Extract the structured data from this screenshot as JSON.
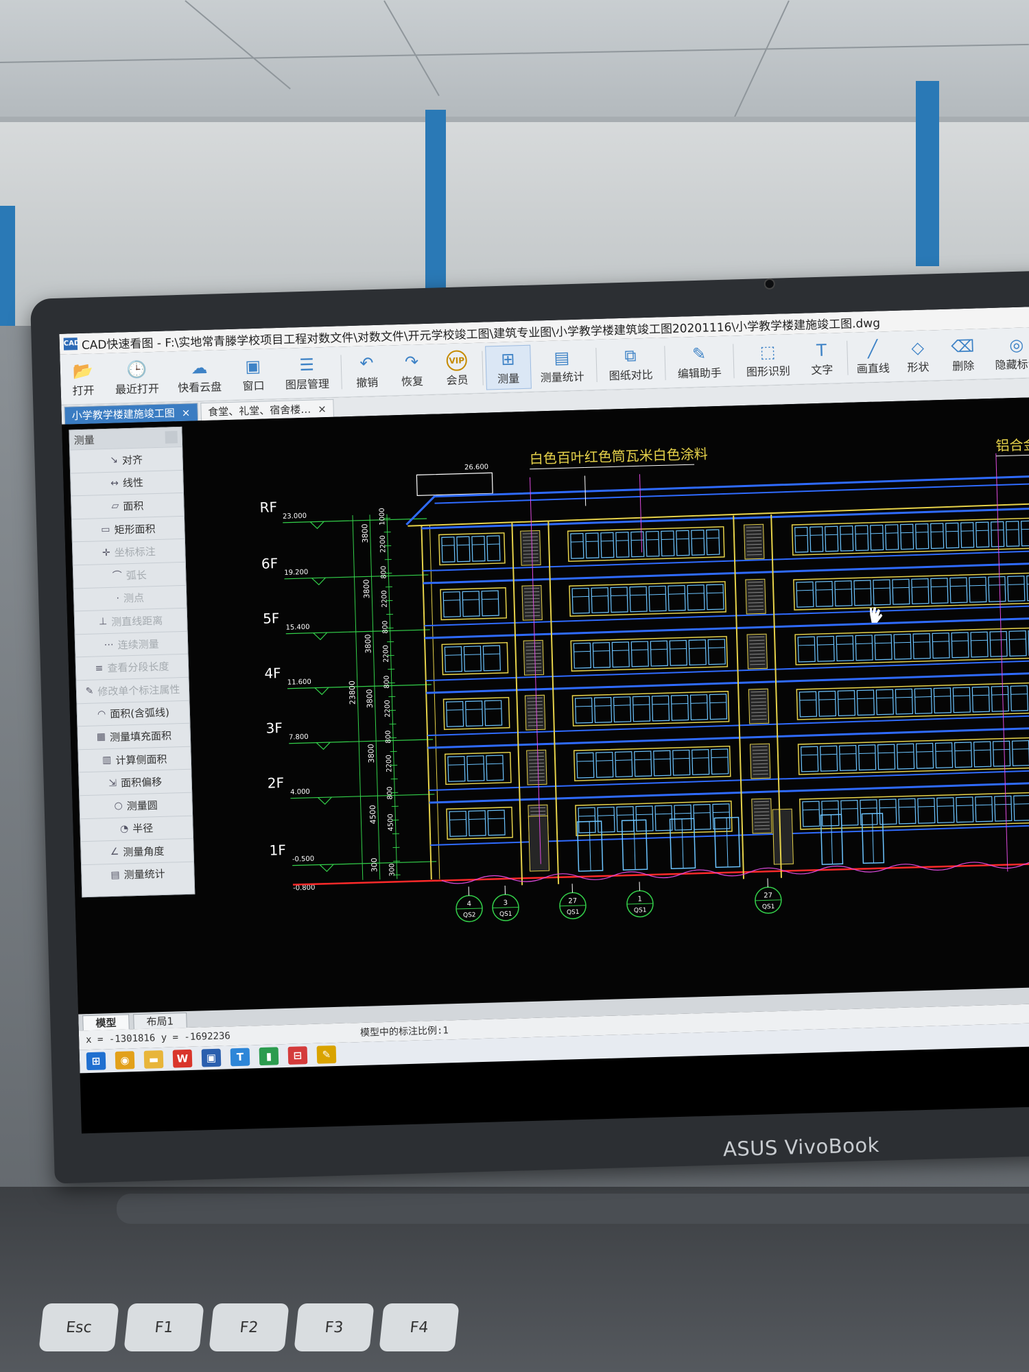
{
  "window_title": "CAD快速看图 - F:\\实地常青滕学校项目工程对数文件\\对数文件\\开元学校竣工图\\建筑专业图\\小学教学楼建筑竣工图20201116\\小学教学楼建施竣工图.dwg",
  "app_icon_text": "CAD",
  "ribbon": [
    {
      "label": "打开",
      "icon": "📂"
    },
    {
      "label": "最近打开",
      "icon": "🕒"
    },
    {
      "label": "快看云盘",
      "icon": "☁"
    },
    {
      "label": "窗口",
      "icon": "▣"
    },
    {
      "label": "图层管理",
      "icon": "☰"
    },
    {
      "label": "撤销",
      "icon": "↶"
    },
    {
      "label": "恢复",
      "icon": "↷"
    },
    {
      "label": "会员",
      "icon": "VIP"
    },
    {
      "label": "测量",
      "icon": "⊞"
    },
    {
      "label": "测量统计",
      "icon": "▤"
    },
    {
      "label": "图纸对比",
      "icon": "⧉"
    },
    {
      "label": "编辑助手",
      "icon": "✎"
    },
    {
      "label": "图形识别",
      "icon": "⬚"
    },
    {
      "label": "文字",
      "icon": "T"
    },
    {
      "label": "画直线",
      "icon": "╱"
    },
    {
      "label": "形状",
      "icon": "◇"
    },
    {
      "label": "删除",
      "icon": "⌫"
    },
    {
      "label": "隐藏标注",
      "icon": "◎"
    }
  ],
  "doc_tabs": [
    {
      "label": "小学教学楼建施竣工图",
      "close": "×",
      "active": true
    },
    {
      "label": "食堂、礼堂、宿舍楼…",
      "close": "×",
      "active": false
    }
  ],
  "measure_panel": {
    "title": "测量",
    "items": [
      {
        "label": "对齐",
        "icon": "↘"
      },
      {
        "label": "线性",
        "icon": "↔"
      },
      {
        "label": "面积",
        "icon": "▱"
      },
      {
        "label": "矩形面积",
        "icon": "▭"
      },
      {
        "label": "坐标标注",
        "icon": "✛"
      },
      {
        "label": "弧长",
        "icon": "⌒"
      },
      {
        "label": "测点",
        "icon": "·"
      },
      {
        "label": "测直线距离",
        "icon": "⊥"
      },
      {
        "label": "连续测量",
        "icon": "⋯"
      },
      {
        "label": "查看分段长度",
        "icon": "≡"
      },
      {
        "label": "修改单个标注属性",
        "icon": "✎"
      },
      {
        "label": "面积(含弧线)",
        "icon": "◠"
      },
      {
        "label": "测量填充面积",
        "icon": "▦"
      },
      {
        "label": "计算侧面积",
        "icon": "▥"
      },
      {
        "label": "面积偏移",
        "icon": "⇲"
      },
      {
        "label": "测量圆",
        "icon": "○"
      },
      {
        "label": "半径",
        "icon": "◔"
      },
      {
        "label": "测量角度",
        "icon": "∠"
      },
      {
        "label": "测量统计",
        "icon": "▤"
      }
    ]
  },
  "drawing": {
    "floors": [
      {
        "name": "RF",
        "level": "23.000"
      },
      {
        "name": "6F",
        "level": "19.200"
      },
      {
        "name": "5F",
        "level": "15.400"
      },
      {
        "name": "4F",
        "level": "11.600"
      },
      {
        "name": "3F",
        "level": "7.800"
      },
      {
        "name": "2F",
        "level": "4.000"
      },
      {
        "name": "1F",
        "level": "-0.500"
      }
    ],
    "ground_level": "-0.800",
    "top_level": "26.600",
    "dims_outer": [
      "3800",
      "3800",
      "3800",
      "3800",
      "3800",
      "4500",
      "300"
    ],
    "dims_inner": [
      "1000",
      "2200",
      "800",
      "2200",
      "800",
      "2200",
      "800",
      "2200",
      "800",
      "2200",
      "800",
      "4500",
      "300"
    ],
    "total_dim": "23800",
    "callouts": [
      "白色百叶",
      "红色筒瓦",
      "米白色涂料",
      "铝合金窗框"
    ],
    "axis_tags": [
      {
        "top": "4",
        "bottom": "QS2"
      },
      {
        "top": "3",
        "bottom": "QS1"
      },
      {
        "top": "27",
        "bottom": "QS1"
      },
      {
        "top": "1",
        "bottom": "QS1"
      },
      {
        "top": "27",
        "bottom": "QS1"
      }
    ]
  },
  "layout_tabs": [
    "模型",
    "布局1"
  ],
  "status": {
    "coords": "x = -1301816 y = -1692236",
    "scale_text": "模型中的标注比例:1"
  },
  "taskbar": [
    {
      "name": "windows-start-icon",
      "glyph": "⊞",
      "color": "#1f6fd0"
    },
    {
      "name": "browser-icon",
      "glyph": "◉",
      "color": "#e2a01a"
    },
    {
      "name": "folder-icon",
      "glyph": "▬",
      "color": "#e8b53a"
    },
    {
      "name": "wps-icon",
      "glyph": "W",
      "color": "#d9352b"
    },
    {
      "name": "cad-icon",
      "glyph": "▣",
      "color": "#2a5fae"
    },
    {
      "name": "text-app-icon",
      "glyph": "T",
      "color": "#2d86d8"
    },
    {
      "name": "green-app-icon",
      "glyph": "▮",
      "color": "#2c9c4f"
    },
    {
      "name": "red-app-icon",
      "glyph": "⊟",
      "color": "#d43b3b"
    },
    {
      "name": "notes-app-icon",
      "glyph": "✎",
      "color": "#d9a300"
    }
  ],
  "laptop_brand": "ASUS VivoBook",
  "keys": [
    "Esc",
    "F1",
    "F2",
    "F3",
    "F4"
  ],
  "colors": {
    "accent": "#3a7cc2",
    "cad_green": "#33d04a",
    "cad_yellow": "#e6d24a",
    "cad_blue": "#2f6bff",
    "cad_cyan": "#6cc4ff",
    "cad_magenta": "#e04be0",
    "cad_red": "#ff2a2a"
  }
}
